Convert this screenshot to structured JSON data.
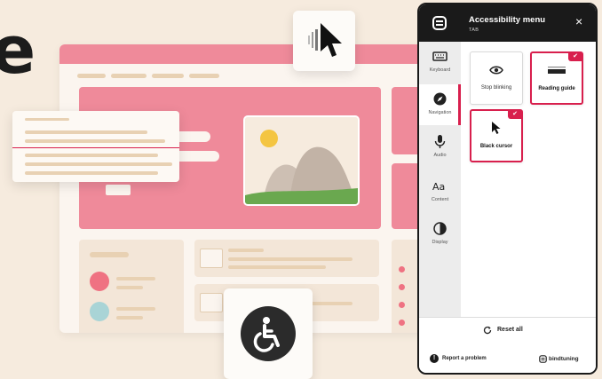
{
  "hero_letter": "e",
  "menu": {
    "title": "Accessibility menu",
    "subtitle": "TAB",
    "close_glyph": "×",
    "logo_icon": "bindtuning-logo-icon",
    "accent_color": "#d81f4d",
    "sidebar": [
      {
        "label": "Keyboard",
        "icon": "keyboard-icon",
        "active": false
      },
      {
        "label": "Navigation",
        "icon": "compass-icon",
        "active": true
      },
      {
        "label": "Audio",
        "icon": "microphone-icon",
        "active": false
      },
      {
        "label": "Content",
        "icon": "text-aa-icon",
        "active": false
      },
      {
        "label": "Display",
        "icon": "contrast-icon",
        "active": false
      }
    ],
    "options": [
      {
        "label": "Stop blinking",
        "icon": "eye-icon",
        "selected": false
      },
      {
        "label": "Reading guide",
        "icon": "reading-guide-icon",
        "selected": true,
        "check": "✔"
      },
      {
        "label": "Black cursor",
        "icon": "cursor-icon",
        "selected": true,
        "check": "✔"
      }
    ],
    "reset_label": "Reset all",
    "report_label": "Report a problem",
    "report_icon_glyph": "!",
    "brand_label": "bindtuning"
  },
  "colors": {
    "background": "#f6ebde",
    "pink": "#ef8a9a",
    "accent": "#d81f4d",
    "dark": "#1a1a1a"
  }
}
